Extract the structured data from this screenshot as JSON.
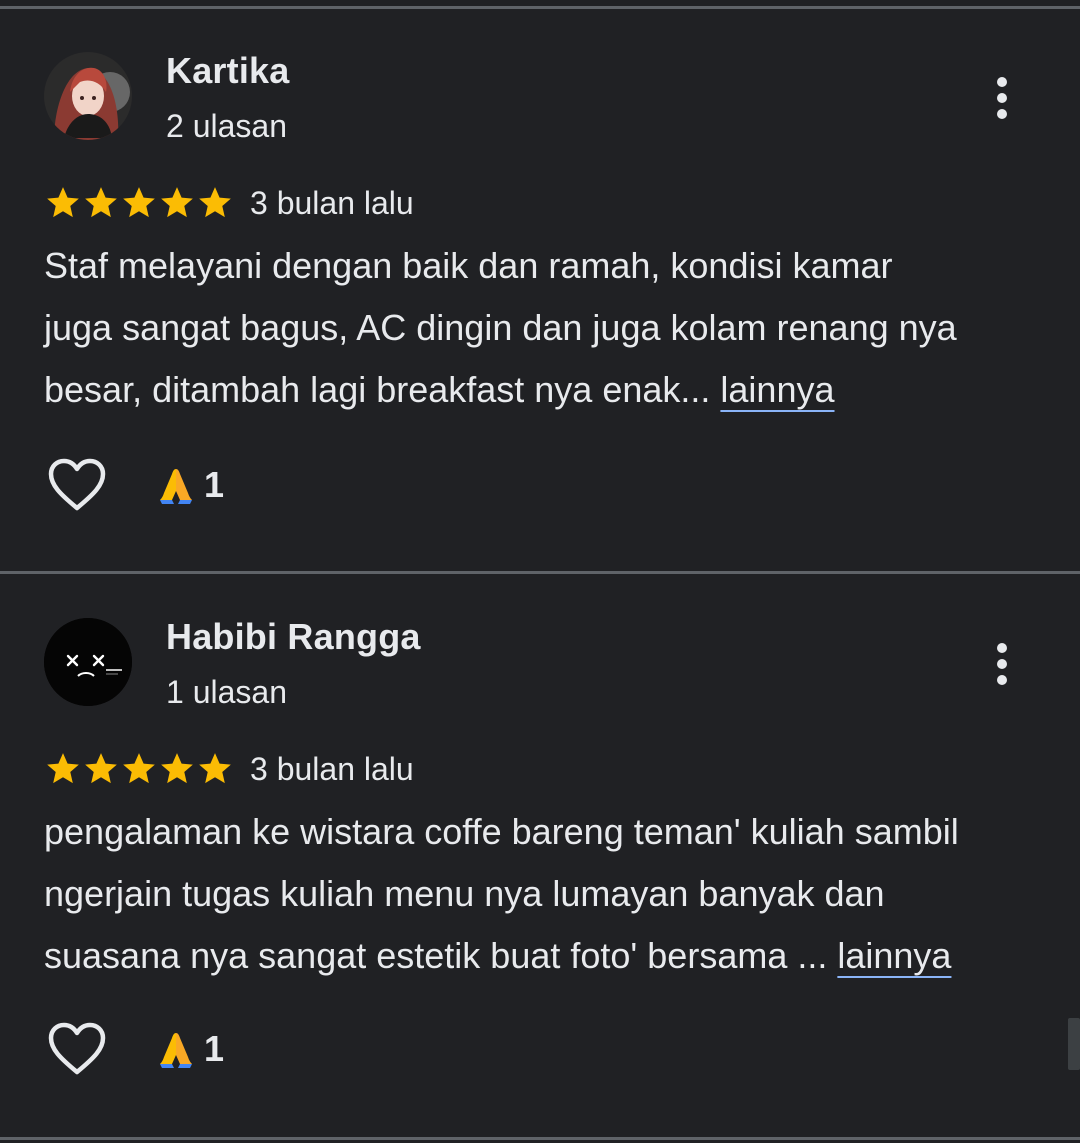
{
  "reviews": [
    {
      "author": "Kartika",
      "review_count": "2 ulasan",
      "rating": 5,
      "time": "3 bulan lalu",
      "text": "Staf melayani dengan baik dan ramah, kondisi kamar\njuga sangat bagus, AC dingin dan juga kolam renang nya\nbesar, ditambah lagi breakfast nya enak... ",
      "more_label": "lainnya",
      "reaction_count": "1",
      "avatar_icon": "anime-portrait-avatar"
    },
    {
      "author": "Habibi Rangga",
      "review_count": "1 ulasan",
      "rating": 5,
      "time": "3 bulan lalu",
      "text": "pengalaman ke wistara coffe bareng teman' kuliah sambil\nngerjain tugas kuliah menu nya lumayan banyak dan\nsuasana nya sangat estetik buat foto' bersama ...  ",
      "more_label": "lainnya",
      "reaction_count": "1",
      "avatar_icon": "sad-face-avatar"
    }
  ],
  "icons": {
    "star": "star-icon",
    "more": "more-vert-icon",
    "like": "heart-outline-icon",
    "reaction": "folded-hands-emoji"
  },
  "colors": {
    "background": "#202124",
    "text": "#e8eaed",
    "star": "#fbbc04",
    "divider": "#5f6368",
    "link_underline": "#8ab4f8"
  }
}
